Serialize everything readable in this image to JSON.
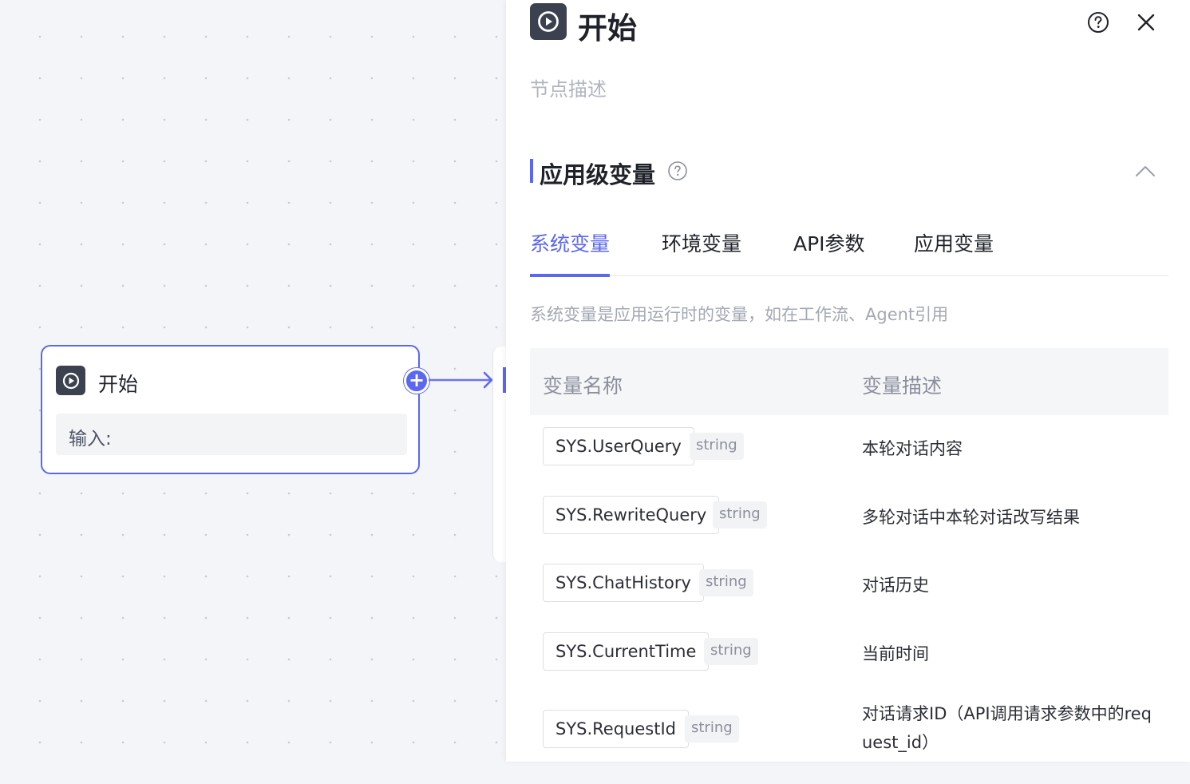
{
  "canvas": {
    "node": {
      "title": "开始",
      "input_label": "输入:",
      "add_symbol": "+"
    }
  },
  "panel": {
    "title": "开始",
    "description_placeholder": "节点描述",
    "section": {
      "title": "应用级变量"
    },
    "tabs": [
      {
        "label": "系统变量",
        "active": true
      },
      {
        "label": "环境变量",
        "active": false
      },
      {
        "label": "API参数",
        "active": false
      },
      {
        "label": "应用变量",
        "active": false
      }
    ],
    "hint": "系统变量是应用运行时的变量，如在工作流、Agent引用",
    "table": {
      "headers": {
        "name": "变量名称",
        "description": "变量描述"
      },
      "rows": [
        {
          "name": "SYS.UserQuery",
          "type": "string",
          "description": "本轮对话内容"
        },
        {
          "name": "SYS.RewriteQuery",
          "type": "string",
          "description": "多轮对话中本轮对话改写结果"
        },
        {
          "name": "SYS.ChatHistory",
          "type": "string",
          "description": "对话历史"
        },
        {
          "name": "SYS.CurrentTime",
          "type": "string",
          "description": "当前时间"
        },
        {
          "name": "SYS.RequestId",
          "type": "string",
          "description": "对话请求ID（API调用请求参数中的request_id）"
        }
      ]
    }
  },
  "colors": {
    "accent": "#5b67f0",
    "icon_bg": "#3c4150"
  }
}
